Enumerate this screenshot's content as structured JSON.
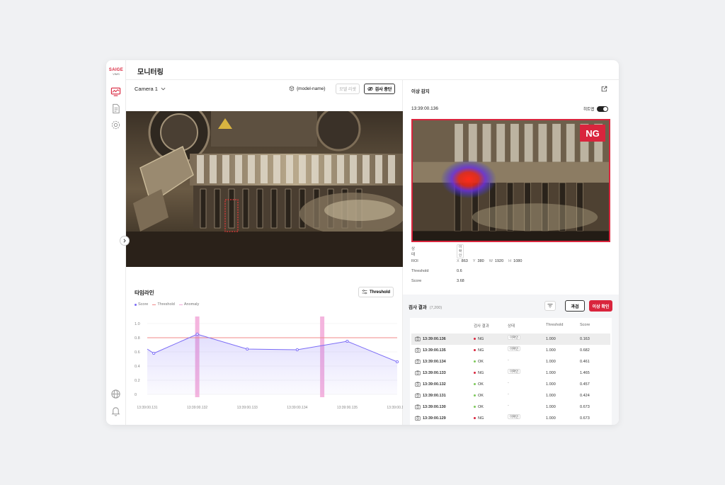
{
  "brand": {
    "line1": "SAIGE",
    "line2": "VIMS"
  },
  "header": {
    "title": "모니터링"
  },
  "camera": {
    "selected": "Camera 1",
    "model": "{model-name}",
    "model_change_label": "모델 리셋",
    "stop_label": "검사 중단"
  },
  "timeline": {
    "title": "타임라인",
    "threshold_button": "Threshold",
    "legend": {
      "score": "Score",
      "threshold": "Threshold",
      "anomaly": "Anomaly"
    }
  },
  "colors": {
    "accent": "#d9253d",
    "score": "#7b6cf6",
    "threshold": "#f08a8a",
    "anomaly": "#f2a8d8",
    "ok": "#7cc95a"
  },
  "chart_data": {
    "type": "line",
    "y_ticks": [
      "1.0",
      "0.8",
      "0.6",
      "0.4",
      "0.2",
      "0"
    ],
    "ylim": [
      0,
      1.0
    ],
    "x_tick_labels": [
      "13:39:00.131",
      "13:39:00.132",
      "13:39:00.133",
      "13:39:00.134",
      "13:39:00.135",
      "13:39:00.136"
    ],
    "threshold": 0.8,
    "series": [
      {
        "name": "Score",
        "x": [
          131.0,
          131.13,
          132.0,
          133.0,
          134.0,
          135.0,
          136.0
        ],
        "values": [
          0.64,
          0.58,
          0.85,
          0.64,
          0.63,
          0.75,
          0.46
        ]
      }
    ],
    "anomaly_x": [
      132.0,
      134.5
    ],
    "grid": true
  },
  "anomaly": {
    "title": "이상 감지",
    "timestamp": "13:39:00.136",
    "heatmap_label": "히트맵",
    "verdict": "NG",
    "status_label": "상태",
    "status_value": "미확인",
    "roi_label": "ROI",
    "roi": {
      "x_label": "X",
      "x": "863",
      "y_label": "Y",
      "y": "380",
      "w_label": "W",
      "w": "1920",
      "h_label": "H",
      "h": "1080"
    },
    "threshold_label": "Threshold",
    "threshold_value": "0.6",
    "score_label": "Score",
    "score_value": "3.68"
  },
  "results": {
    "title": "검사 결과",
    "count": "(7,200)",
    "past_label": "과검",
    "confirm_label": "이상 확인",
    "columns": [
      "검사 결과",
      "상태",
      "Threshold",
      "Score"
    ],
    "rows": [
      {
        "time": "13:39:00.136",
        "result": "NG",
        "status": "미확인",
        "threshold": "1.000",
        "score": "0.163"
      },
      {
        "time": "13:39:00.135",
        "result": "NG",
        "status": "미확인",
        "threshold": "1.000",
        "score": "0.682"
      },
      {
        "time": "13:39:00.134",
        "result": "OK",
        "status": "-",
        "threshold": "1.000",
        "score": "0.461"
      },
      {
        "time": "13:39:00.133",
        "result": "NG",
        "status": "미확인",
        "threshold": "1.000",
        "score": "1.465"
      },
      {
        "time": "13:39:00.132",
        "result": "OK",
        "status": "-",
        "threshold": "1.000",
        "score": "0.457"
      },
      {
        "time": "13:39:00.131",
        "result": "OK",
        "status": "-",
        "threshold": "1.000",
        "score": "0.424"
      },
      {
        "time": "13:39:00.130",
        "result": "OK",
        "status": "-",
        "threshold": "1.000",
        "score": "0.673"
      },
      {
        "time": "13:39:00.129",
        "result": "NG",
        "status": "미확인",
        "threshold": "1.000",
        "score": "0.673"
      }
    ]
  }
}
